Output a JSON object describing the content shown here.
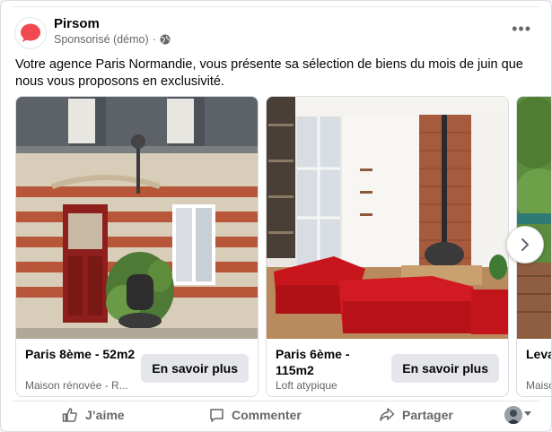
{
  "post": {
    "page_name": "Pirsom",
    "sponsored_label": "Sponsorisé (démo)",
    "separator": "·",
    "text": "Votre agence Paris Normandie, vous présente sa sélection de biens du mois de juin que nous vous proposons en exclusivité.",
    "more_icon": "more-options-icon",
    "audience_icon": "globe-icon",
    "brand_color": "#f0494f"
  },
  "carousel": {
    "items": [
      {
        "title": "Paris 8ème - 52m2",
        "subtitle": "Maison rénovée - R...",
        "cta": "En savoir plus",
        "image": "townhouse-facade-red-door"
      },
      {
        "title": "Paris 6ème - 115m2",
        "subtitle": "Loft atypique",
        "cta": "En savoir plus",
        "image": "loft-living-room-red-sofas"
      },
      {
        "title": "Leva",
        "subtitle": "Maiso",
        "cta": "",
        "image": "garden-terrace"
      }
    ],
    "next_icon": "chevron-right-icon"
  },
  "actions": {
    "like": "J’aime",
    "comment": "Commenter",
    "share": "Partager",
    "like_icon": "thumbs-up-icon",
    "comment_icon": "comment-icon",
    "share_icon": "share-icon"
  }
}
